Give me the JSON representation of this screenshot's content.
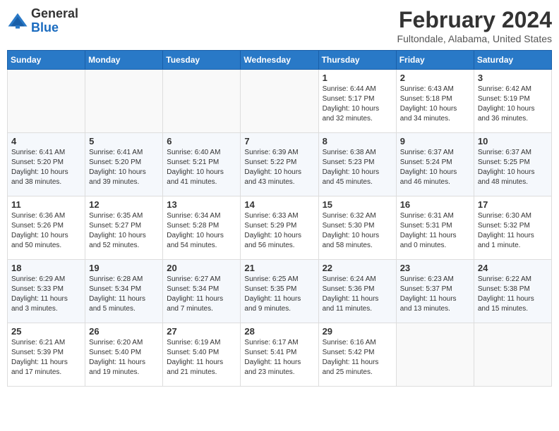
{
  "logo": {
    "general": "General",
    "blue": "Blue"
  },
  "title": "February 2024",
  "location": "Fultondale, Alabama, United States",
  "days_header": [
    "Sunday",
    "Monday",
    "Tuesday",
    "Wednesday",
    "Thursday",
    "Friday",
    "Saturday"
  ],
  "weeks": [
    [
      {
        "day": "",
        "info": ""
      },
      {
        "day": "",
        "info": ""
      },
      {
        "day": "",
        "info": ""
      },
      {
        "day": "",
        "info": ""
      },
      {
        "day": "1",
        "info": "Sunrise: 6:44 AM\nSunset: 5:17 PM\nDaylight: 10 hours\nand 32 minutes."
      },
      {
        "day": "2",
        "info": "Sunrise: 6:43 AM\nSunset: 5:18 PM\nDaylight: 10 hours\nand 34 minutes."
      },
      {
        "day": "3",
        "info": "Sunrise: 6:42 AM\nSunset: 5:19 PM\nDaylight: 10 hours\nand 36 minutes."
      }
    ],
    [
      {
        "day": "4",
        "info": "Sunrise: 6:41 AM\nSunset: 5:20 PM\nDaylight: 10 hours\nand 38 minutes."
      },
      {
        "day": "5",
        "info": "Sunrise: 6:41 AM\nSunset: 5:20 PM\nDaylight: 10 hours\nand 39 minutes."
      },
      {
        "day": "6",
        "info": "Sunrise: 6:40 AM\nSunset: 5:21 PM\nDaylight: 10 hours\nand 41 minutes."
      },
      {
        "day": "7",
        "info": "Sunrise: 6:39 AM\nSunset: 5:22 PM\nDaylight: 10 hours\nand 43 minutes."
      },
      {
        "day": "8",
        "info": "Sunrise: 6:38 AM\nSunset: 5:23 PM\nDaylight: 10 hours\nand 45 minutes."
      },
      {
        "day": "9",
        "info": "Sunrise: 6:37 AM\nSunset: 5:24 PM\nDaylight: 10 hours\nand 46 minutes."
      },
      {
        "day": "10",
        "info": "Sunrise: 6:37 AM\nSunset: 5:25 PM\nDaylight: 10 hours\nand 48 minutes."
      }
    ],
    [
      {
        "day": "11",
        "info": "Sunrise: 6:36 AM\nSunset: 5:26 PM\nDaylight: 10 hours\nand 50 minutes."
      },
      {
        "day": "12",
        "info": "Sunrise: 6:35 AM\nSunset: 5:27 PM\nDaylight: 10 hours\nand 52 minutes."
      },
      {
        "day": "13",
        "info": "Sunrise: 6:34 AM\nSunset: 5:28 PM\nDaylight: 10 hours\nand 54 minutes."
      },
      {
        "day": "14",
        "info": "Sunrise: 6:33 AM\nSunset: 5:29 PM\nDaylight: 10 hours\nand 56 minutes."
      },
      {
        "day": "15",
        "info": "Sunrise: 6:32 AM\nSunset: 5:30 PM\nDaylight: 10 hours\nand 58 minutes."
      },
      {
        "day": "16",
        "info": "Sunrise: 6:31 AM\nSunset: 5:31 PM\nDaylight: 11 hours\nand 0 minutes."
      },
      {
        "day": "17",
        "info": "Sunrise: 6:30 AM\nSunset: 5:32 PM\nDaylight: 11 hours\nand 1 minute."
      }
    ],
    [
      {
        "day": "18",
        "info": "Sunrise: 6:29 AM\nSunset: 5:33 PM\nDaylight: 11 hours\nand 3 minutes."
      },
      {
        "day": "19",
        "info": "Sunrise: 6:28 AM\nSunset: 5:34 PM\nDaylight: 11 hours\nand 5 minutes."
      },
      {
        "day": "20",
        "info": "Sunrise: 6:27 AM\nSunset: 5:34 PM\nDaylight: 11 hours\nand 7 minutes."
      },
      {
        "day": "21",
        "info": "Sunrise: 6:25 AM\nSunset: 5:35 PM\nDaylight: 11 hours\nand 9 minutes."
      },
      {
        "day": "22",
        "info": "Sunrise: 6:24 AM\nSunset: 5:36 PM\nDaylight: 11 hours\nand 11 minutes."
      },
      {
        "day": "23",
        "info": "Sunrise: 6:23 AM\nSunset: 5:37 PM\nDaylight: 11 hours\nand 13 minutes."
      },
      {
        "day": "24",
        "info": "Sunrise: 6:22 AM\nSunset: 5:38 PM\nDaylight: 11 hours\nand 15 minutes."
      }
    ],
    [
      {
        "day": "25",
        "info": "Sunrise: 6:21 AM\nSunset: 5:39 PM\nDaylight: 11 hours\nand 17 minutes."
      },
      {
        "day": "26",
        "info": "Sunrise: 6:20 AM\nSunset: 5:40 PM\nDaylight: 11 hours\nand 19 minutes."
      },
      {
        "day": "27",
        "info": "Sunrise: 6:19 AM\nSunset: 5:40 PM\nDaylight: 11 hours\nand 21 minutes."
      },
      {
        "day": "28",
        "info": "Sunrise: 6:17 AM\nSunset: 5:41 PM\nDaylight: 11 hours\nand 23 minutes."
      },
      {
        "day": "29",
        "info": "Sunrise: 6:16 AM\nSunset: 5:42 PM\nDaylight: 11 hours\nand 25 minutes."
      },
      {
        "day": "",
        "info": ""
      },
      {
        "day": "",
        "info": ""
      }
    ]
  ]
}
